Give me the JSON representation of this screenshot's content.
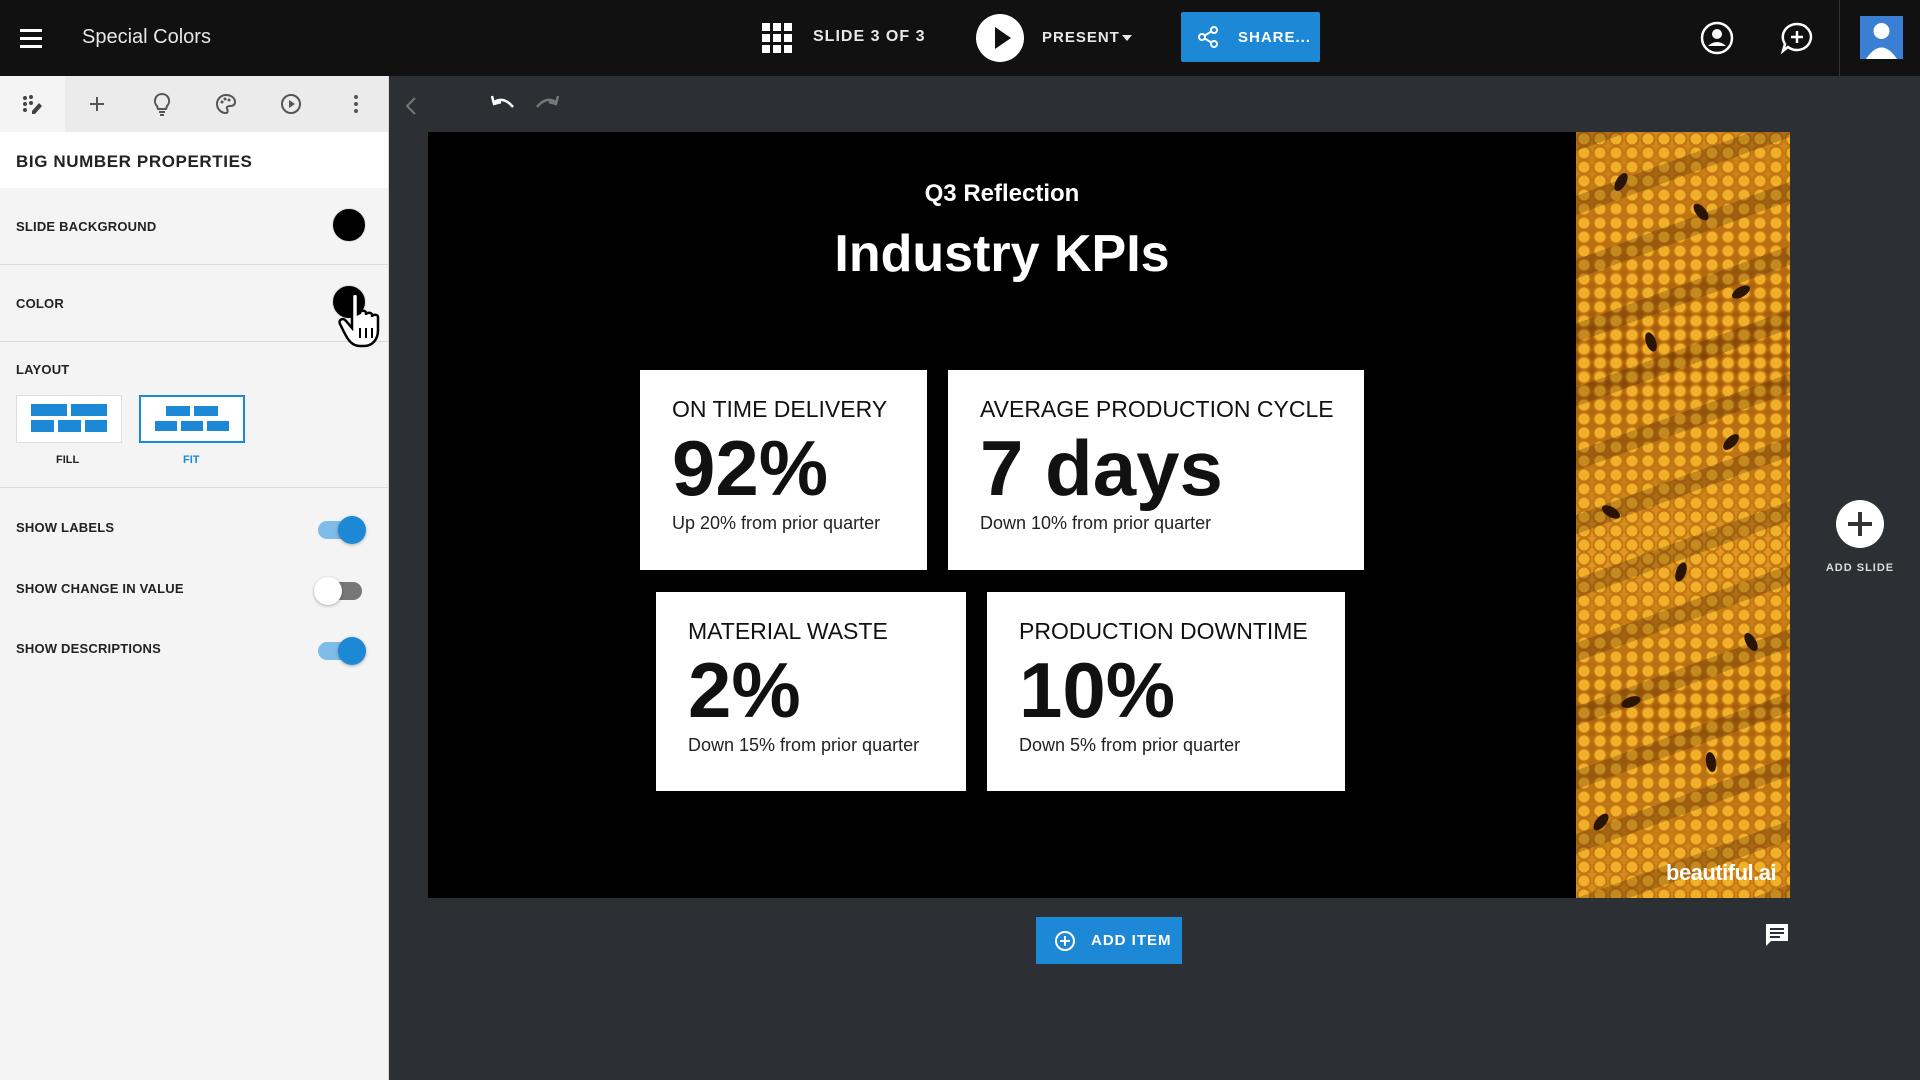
{
  "app": {
    "presentation_title": "Special Colors",
    "slide_counter": "SLIDE 3 OF 3",
    "present_label": "PRESENT",
    "share_label": "SHARE...",
    "watermark": "beautiful.ai"
  },
  "icons": {
    "menu": "hamburger-menu-icon",
    "grid": "grid-icon",
    "play": "play-icon",
    "share": "share-icon",
    "user": "user-circle-icon",
    "comment": "add-comment-icon",
    "undo": "undo-icon",
    "redo": "redo-icon",
    "notes": "speaker-notes-icon",
    "add_item": "plus-circle-icon"
  },
  "panel": {
    "tabs": [
      "sparkle-edit",
      "add",
      "lightbulb",
      "palette",
      "play"
    ],
    "title": "BIG NUMBER PROPERTIES",
    "slide_background_label": "SLIDE BACKGROUND",
    "slide_background_color": "#000000",
    "color_label": "COLOR",
    "color_value": "#000000",
    "layout_label": "LAYOUT",
    "layout_options": [
      {
        "label": "FILL",
        "selected": false
      },
      {
        "label": "FIT",
        "selected": true
      }
    ],
    "toggles": [
      {
        "label": "SHOW LABELS",
        "on": true
      },
      {
        "label": "SHOW CHANGE IN VALUE",
        "on": false
      },
      {
        "label": "SHOW DESCRIPTIONS",
        "on": true
      }
    ]
  },
  "slide": {
    "subtitle": "Q3 Reflection",
    "title": "Industry KPIs",
    "cards": [
      {
        "label": "ON TIME DELIVERY",
        "value": "92%",
        "desc": "Up 20% from prior quarter"
      },
      {
        "label": "AVERAGE PRODUCTION CYCLE",
        "value": "7 days",
        "desc": "Down 10% from prior quarter"
      },
      {
        "label": "MATERIAL WASTE",
        "value": "2%",
        "desc": "Down 15% from prior quarter"
      },
      {
        "label": "PRODUCTION DOWNTIME",
        "value": "10%",
        "desc": "Down 5% from prior quarter"
      }
    ]
  },
  "actions": {
    "add_slide": "ADD SLIDE",
    "add_item": "ADD ITEM"
  },
  "colors": {
    "accent": "#1d88d6",
    "topbar": "#111111",
    "canvas_bg": "#2c2f33",
    "panel_bg": "#f4f4f4"
  }
}
